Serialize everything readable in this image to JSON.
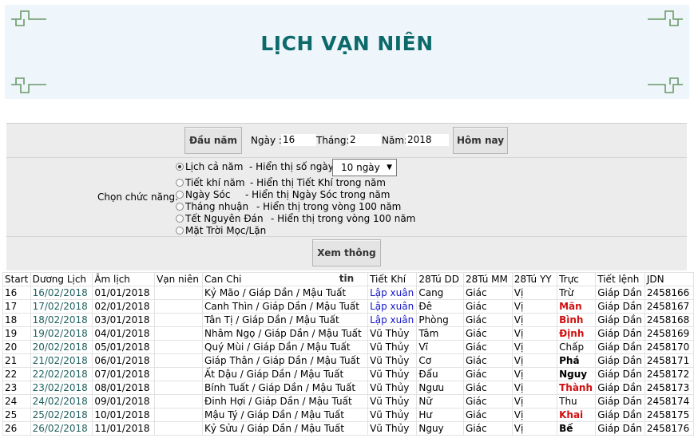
{
  "header": {
    "title": "LỊCH VẠN NIÊN"
  },
  "controls": {
    "btn_start_year": "Đầu năm",
    "day_label": "Ngày :",
    "day_value": "16",
    "month_label": "Tháng:",
    "month_value": "2",
    "year_label": "Năm:",
    "year_value": "2018",
    "btn_today": "Hôm nay",
    "choose_label": "Chọn chức năng:",
    "options": [
      {
        "label": "Lịch cả năm",
        "desc": "- Hiển thị số ngày:",
        "selected": true
      },
      {
        "label": "Tiết khí năm",
        "desc": "- Hiển thị Tiết Khí trong năm",
        "selected": false
      },
      {
        "label": "Ngày Sóc",
        "desc": "- Hiển thị Ngày Sóc trong năm",
        "selected": false
      },
      {
        "label": "Tháng nhuận",
        "desc": "- Hiển thị trong vòng 100 năm",
        "selected": false
      },
      {
        "label": "Tết Nguyên Đán",
        "desc": "- Hiển thị trong vòng 100 năm",
        "selected": false
      },
      {
        "label": "Mặt Trời Mọc/Lặn",
        "desc": "",
        "selected": false
      }
    ],
    "days_select": "10 ngày",
    "btn_view": "Xem thông tin"
  },
  "table": {
    "headers": [
      "Start",
      "Dương Lịch",
      "Âm lịch",
      "Vạn niên",
      "Can Chi",
      "Tiết Khí",
      "28Tú DD",
      "28Tú MM",
      "28Tú YY",
      "Trực",
      "Tiết lệnh",
      "JDN"
    ],
    "rows": [
      [
        "16",
        "16/02/2018",
        "01/01/2018",
        "",
        "Kỷ Mão / Giáp Dần / Mậu Tuất",
        "Lập xuân",
        "Cang",
        "Giác",
        "Vị",
        "Trừ",
        "Giáp Dần",
        "2458166"
      ],
      [
        "17",
        "17/02/2018",
        "02/01/2018",
        "",
        "Canh Thìn / Giáp Dần / Mậu Tuất",
        "Lập xuân",
        "Đê",
        "Giác",
        "Vị",
        "Mãn",
        "Giáp Dần",
        "2458167"
      ],
      [
        "18",
        "18/02/2018",
        "03/01/2018",
        "",
        "Tân Tị / Giáp Dần / Mậu Tuất",
        "Lập xuân",
        "Phòng",
        "Giác",
        "Vị",
        "Bình",
        "Giáp Dần",
        "2458168"
      ],
      [
        "19",
        "19/02/2018",
        "04/01/2018",
        "",
        "Nhâm Ngọ / Giáp Dần / Mậu Tuất",
        "Vũ Thủy",
        "Tâm",
        "Giác",
        "Vị",
        "Định",
        "Giáp Dần",
        "2458169"
      ],
      [
        "20",
        "20/02/2018",
        "05/01/2018",
        "",
        "Quý Mùi / Giáp Dần / Mậu Tuất",
        "Vũ Thủy",
        "Vĩ",
        "Giác",
        "Vị",
        "Chấp",
        "Giáp Dần",
        "2458170"
      ],
      [
        "21",
        "21/02/2018",
        "06/01/2018",
        "",
        "Giáp Thân / Giáp Dần / Mậu Tuất",
        "Vũ Thủy",
        "Cơ",
        "Giác",
        "Vị",
        "Phá",
        "Giáp Dần",
        "2458171"
      ],
      [
        "22",
        "22/02/2018",
        "07/01/2018",
        "",
        "Ất Dậu / Giáp Dần / Mậu Tuất",
        "Vũ Thủy",
        "Đẩu",
        "Giác",
        "Vị",
        "Nguy",
        "Giáp Dần",
        "2458172"
      ],
      [
        "23",
        "23/02/2018",
        "08/01/2018",
        "",
        "Bính Tuất / Giáp Dần / Mậu Tuất",
        "Vũ Thủy",
        "Ngưu",
        "Giác",
        "Vị",
        "Thành",
        "Giáp Dần",
        "2458173"
      ],
      [
        "24",
        "24/02/2018",
        "09/01/2018",
        "",
        "Đinh Hợi / Giáp Dần / Mậu Tuất",
        "Vũ Thủy",
        "Nữ",
        "Giác",
        "Vị",
        "Thu",
        "Giáp Dần",
        "2458174"
      ],
      [
        "25",
        "25/02/2018",
        "10/01/2018",
        "",
        "Mậu Tý / Giáp Dần / Mậu Tuất",
        "Vũ Thủy",
        "Hư",
        "Giác",
        "Vị",
        "Khai",
        "Giáp Dần",
        "2458175"
      ],
      [
        "26",
        "26/02/2018",
        "11/01/2018",
        "",
        "Kỷ Sửu / Giáp Dần / Mậu Tuất",
        "Vũ Thủy",
        "Nguy",
        "Giác",
        "Vị",
        "Bế",
        "Giáp Dần",
        "2458176"
      ]
    ],
    "truc_styles": [
      "normal",
      "red",
      "red",
      "red",
      "normal",
      "bold",
      "bold",
      "red",
      "normal",
      "red",
      "bold"
    ],
    "tietkhi_blue_rows": 3
  },
  "colors": {
    "title": "#0d6a6a",
    "banner_bg": "#eef5fb",
    "panel_bg": "#ececec",
    "date_text": "#1f5f5f",
    "red": "#d01010",
    "blue": "#1515c8"
  }
}
